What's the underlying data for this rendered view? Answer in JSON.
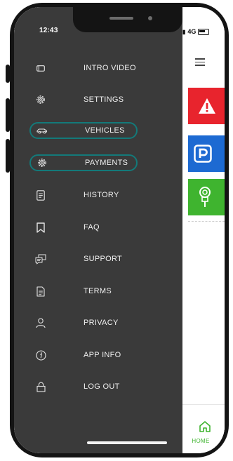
{
  "status_bar": {
    "time": "12:43",
    "network": "4G"
  },
  "drawer": {
    "items": [
      {
        "label": "INTRO VIDEO",
        "icon": "video-icon",
        "highlighted": false
      },
      {
        "label": "SETTINGS",
        "icon": "gear-icon",
        "highlighted": false
      },
      {
        "label": "VEHICLES",
        "icon": "car-icon",
        "highlighted": true
      },
      {
        "label": "PAYMENTS",
        "icon": "gear-icon",
        "highlighted": true
      },
      {
        "label": "HISTORY",
        "icon": "document-icon",
        "highlighted": false
      },
      {
        "label": "FAQ",
        "icon": "bookmark-icon",
        "highlighted": false
      },
      {
        "label": "SUPPORT",
        "icon": "chat-icon",
        "highlighted": false
      },
      {
        "label": "TERMS",
        "icon": "file-text-icon",
        "highlighted": false
      },
      {
        "label": "PRIVACY",
        "icon": "user-icon",
        "highlighted": false
      },
      {
        "label": "APP INFO",
        "icon": "info-icon",
        "highlighted": false
      },
      {
        "label": "LOG OUT",
        "icon": "lock-icon",
        "highlighted": false
      }
    ]
  },
  "main": {
    "bottom_nav": {
      "home_label": "HOME"
    },
    "tiles": [
      {
        "icon": "warning-icon",
        "color": "#e8242d"
      },
      {
        "icon": "parking-icon",
        "color": "#1d6ad2"
      },
      {
        "icon": "parking-meter-icon",
        "color": "#3fb42f"
      }
    ]
  },
  "colors": {
    "drawer_bg": "#3a3a3a",
    "highlight_border": "#137a7a",
    "accent_green": "#3fb42f"
  }
}
